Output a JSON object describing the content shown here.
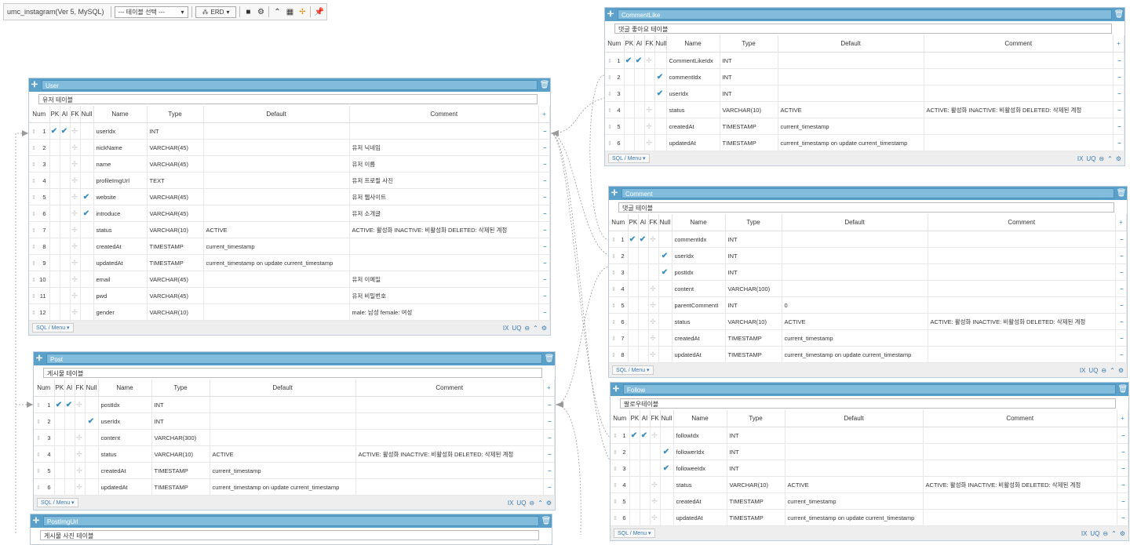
{
  "toolbar": {
    "title": "umc_instagram(Ver 5, MySQL)",
    "table_select": "--- 테이블 선택 ---",
    "erd_button": "ERD"
  },
  "columns_header": {
    "num": "Num",
    "pk": "PK",
    "ai": "AI",
    "fk": "FK",
    "null": "Null",
    "name": "Name",
    "type": "Type",
    "default": "Default",
    "comment": "Comment"
  },
  "footer": {
    "sql_menu": "SQL / Menu",
    "ix": "IX",
    "uq": "UQ"
  },
  "tables": {
    "user": {
      "name": "User",
      "comment": "유저 테이블",
      "rows": [
        {
          "num": "1",
          "pk": true,
          "ai": true,
          "fk": false,
          "null": false,
          "name": "userIdx",
          "type": "INT",
          "default": "",
          "comment": ""
        },
        {
          "num": "2",
          "pk": false,
          "ai": false,
          "fk": false,
          "null": false,
          "name": "nickName",
          "type": "VARCHAR(45)",
          "default": "",
          "comment": "유저 닉네임"
        },
        {
          "num": "3",
          "pk": false,
          "ai": false,
          "fk": false,
          "null": false,
          "name": "name",
          "type": "VARCHAR(45)",
          "default": "",
          "comment": "유저 이름"
        },
        {
          "num": "4",
          "pk": false,
          "ai": false,
          "fk": false,
          "null": false,
          "name": "profileImgUrl",
          "type": "TEXT",
          "default": "",
          "comment": "유저 프로필 사진"
        },
        {
          "num": "5",
          "pk": false,
          "ai": false,
          "fk": false,
          "null": true,
          "name": "website",
          "type": "VARCHAR(45)",
          "default": "",
          "comment": "유저 웹사이트"
        },
        {
          "num": "6",
          "pk": false,
          "ai": false,
          "fk": false,
          "null": true,
          "name": "introduce",
          "type": "VARCHAR(45)",
          "default": "",
          "comment": "유저 소개글"
        },
        {
          "num": "7",
          "pk": false,
          "ai": false,
          "fk": false,
          "null": false,
          "name": "status",
          "type": "VARCHAR(10)",
          "default": "ACTIVE",
          "comment": "ACTIVE: 활성화 INACTIVE: 비활성화 DELETED: 삭제된 계정"
        },
        {
          "num": "8",
          "pk": false,
          "ai": false,
          "fk": false,
          "null": false,
          "name": "createdAt",
          "type": "TIMESTAMP",
          "default": "current_timestamp",
          "comment": ""
        },
        {
          "num": "9",
          "pk": false,
          "ai": false,
          "fk": false,
          "null": false,
          "name": "updatedAt",
          "type": "TIMESTAMP",
          "default": "current_timestamp on update current_timestamp",
          "comment": ""
        },
        {
          "num": "10",
          "pk": false,
          "ai": false,
          "fk": false,
          "null": false,
          "name": "email",
          "type": "VARCHAR(45)",
          "default": "",
          "comment": "유저 이메일"
        },
        {
          "num": "11",
          "pk": false,
          "ai": false,
          "fk": false,
          "null": false,
          "name": "pwd",
          "type": "VARCHAR(45)",
          "default": "",
          "comment": "유저 비밀번호"
        },
        {
          "num": "12",
          "pk": false,
          "ai": false,
          "fk": false,
          "null": false,
          "name": "gender",
          "type": "VARCHAR(10)",
          "default": "",
          "comment": "male: 남성 female: 여성"
        }
      ]
    },
    "post": {
      "name": "Post",
      "comment": "게시물 테이블",
      "rows": [
        {
          "num": "1",
          "pk": true,
          "ai": true,
          "fk": false,
          "null": false,
          "name": "postIdx",
          "type": "INT",
          "default": "",
          "comment": ""
        },
        {
          "num": "2",
          "pk": false,
          "ai": false,
          "fk": true,
          "null": false,
          "name": "userIdx",
          "type": "INT",
          "default": "",
          "comment": ""
        },
        {
          "num": "3",
          "pk": false,
          "ai": false,
          "fk": false,
          "null": false,
          "name": "content",
          "type": "VARCHAR(300)",
          "default": "",
          "comment": ""
        },
        {
          "num": "4",
          "pk": false,
          "ai": false,
          "fk": false,
          "null": false,
          "name": "status",
          "type": "VARCHAR(10)",
          "default": "ACTIVE",
          "comment": "ACTIVE: 활성화 INACTIVE: 비활성화 DELETED: 삭제된 계정"
        },
        {
          "num": "5",
          "pk": false,
          "ai": false,
          "fk": false,
          "null": false,
          "name": "createdAt",
          "type": "TIMESTAMP",
          "default": "current_timestamp",
          "comment": ""
        },
        {
          "num": "6",
          "pk": false,
          "ai": false,
          "fk": false,
          "null": false,
          "name": "updatedAt",
          "type": "TIMESTAMP",
          "default": "current_timestamp on update current_timestamp",
          "comment": ""
        }
      ]
    },
    "postimgurl": {
      "name": "PostImgUrl",
      "comment": "게시물 사진 테이블"
    },
    "commentlike": {
      "name": "CommentLike",
      "comment": "댓글 좋아요 테이블",
      "rows": [
        {
          "num": "1",
          "pk": true,
          "ai": true,
          "fk": false,
          "null": false,
          "name": "CommentLikeIdx",
          "type": "INT",
          "default": "",
          "comment": ""
        },
        {
          "num": "2",
          "pk": false,
          "ai": false,
          "fk": true,
          "null": false,
          "name": "commentIdx",
          "type": "INT",
          "default": "",
          "comment": ""
        },
        {
          "num": "3",
          "pk": false,
          "ai": false,
          "fk": true,
          "null": false,
          "name": "userIdx",
          "type": "INT",
          "default": "",
          "comment": ""
        },
        {
          "num": "4",
          "pk": false,
          "ai": false,
          "fk": false,
          "null": false,
          "name": "status",
          "type": "VARCHAR(10)",
          "default": "ACTIVE",
          "comment": "ACTIVE: 활성화 INACTIVE: 비활성화 DELETED: 삭제된 계정"
        },
        {
          "num": "5",
          "pk": false,
          "ai": false,
          "fk": false,
          "null": false,
          "name": "createdAt",
          "type": "TIMESTAMP",
          "default": "current_timestamp",
          "comment": ""
        },
        {
          "num": "6",
          "pk": false,
          "ai": false,
          "fk": false,
          "null": false,
          "name": "updatedAt",
          "type": "TIMESTAMP",
          "default": "current_timestamp on update current_timestamp",
          "comment": ""
        }
      ]
    },
    "comment": {
      "name": "Comment",
      "comment": "댓글 테이블",
      "rows": [
        {
          "num": "1",
          "pk": true,
          "ai": true,
          "fk": false,
          "null": false,
          "name": "commentIdx",
          "type": "INT",
          "default": "",
          "comment": ""
        },
        {
          "num": "2",
          "pk": false,
          "ai": false,
          "fk": true,
          "null": false,
          "name": "userIdx",
          "type": "INT",
          "default": "",
          "comment": ""
        },
        {
          "num": "3",
          "pk": false,
          "ai": false,
          "fk": true,
          "null": false,
          "name": "postIdx",
          "type": "INT",
          "default": "",
          "comment": ""
        },
        {
          "num": "4",
          "pk": false,
          "ai": false,
          "fk": false,
          "null": false,
          "name": "content",
          "type": "VARCHAR(100)",
          "default": "",
          "comment": ""
        },
        {
          "num": "5",
          "pk": false,
          "ai": false,
          "fk": false,
          "null": false,
          "name": "parentCommentI",
          "type": "INT",
          "default": "0",
          "comment": ""
        },
        {
          "num": "6",
          "pk": false,
          "ai": false,
          "fk": false,
          "null": false,
          "name": "status",
          "type": "VARCHAR(10)",
          "default": "ACTIVE",
          "comment": "ACTIVE: 활성화 INACTIVE: 비활성화 DELETED: 삭제된 계정"
        },
        {
          "num": "7",
          "pk": false,
          "ai": false,
          "fk": false,
          "null": false,
          "name": "createdAt",
          "type": "TIMESTAMP",
          "default": "current_timestamp",
          "comment": ""
        },
        {
          "num": "8",
          "pk": false,
          "ai": false,
          "fk": false,
          "null": false,
          "name": "updatedAt",
          "type": "TIMESTAMP",
          "default": "current_timestamp on update current_timestamp",
          "comment": ""
        }
      ]
    },
    "follow": {
      "name": "Follow",
      "comment": "팔로우테이블",
      "rows": [
        {
          "num": "1",
          "pk": true,
          "ai": true,
          "fk": false,
          "null": false,
          "name": "followIdx",
          "type": "INT",
          "default": "",
          "comment": ""
        },
        {
          "num": "2",
          "pk": false,
          "ai": false,
          "fk": true,
          "null": false,
          "name": "followerIdx",
          "type": "INT",
          "default": "",
          "comment": ""
        },
        {
          "num": "3",
          "pk": false,
          "ai": false,
          "fk": true,
          "null": false,
          "name": "followeeIdx",
          "type": "INT",
          "default": "",
          "comment": ""
        },
        {
          "num": "4",
          "pk": false,
          "ai": false,
          "fk": false,
          "null": false,
          "name": "status",
          "type": "VARCHAR(10)",
          "default": "ACTIVE",
          "comment": "ACTIVE: 활성화 INACTIVE: 비활성화 DELETED: 삭제된 계정"
        },
        {
          "num": "5",
          "pk": false,
          "ai": false,
          "fk": false,
          "null": false,
          "name": "createdAt",
          "type": "TIMESTAMP",
          "default": "current_timestamp",
          "comment": ""
        },
        {
          "num": "6",
          "pk": false,
          "ai": false,
          "fk": false,
          "null": false,
          "name": "updatedAt",
          "type": "TIMESTAMP",
          "default": "current_timestamp on update current_timestamp",
          "comment": ""
        }
      ]
    }
  }
}
